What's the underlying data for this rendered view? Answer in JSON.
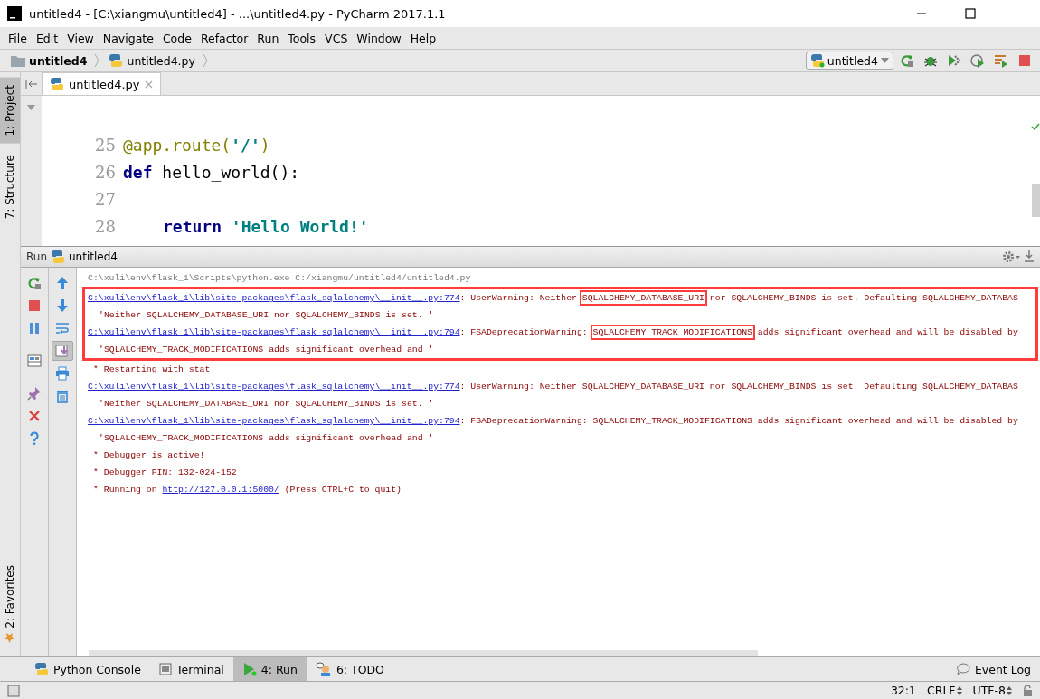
{
  "window": {
    "title": "untitled4 - [C:\\xiangmu\\untitled4] - ...\\untitled4.py - PyCharm 2017.1.1"
  },
  "menu": [
    "File",
    "Edit",
    "View",
    "Navigate",
    "Code",
    "Refactor",
    "Run",
    "Tools",
    "VCS",
    "Window",
    "Help"
  ],
  "breadcrumbs": [
    {
      "label": "untitled4",
      "kind": "folder"
    },
    {
      "label": "untitled4.py",
      "kind": "python"
    }
  ],
  "run_config": {
    "label": "untitled4"
  },
  "tool_stripe": {
    "top": [
      {
        "label": "1: Project",
        "selected": true
      },
      {
        "label": "7: Structure",
        "selected": false
      }
    ],
    "bottom": [
      {
        "label": "2: Favorites",
        "selected": false
      }
    ]
  },
  "editor": {
    "tabs": [
      {
        "label": "untitled4.py",
        "selected": true
      }
    ],
    "lines": [
      {
        "number": "25",
        "tokens": [
          {
            "text": "@app.route(",
            "kind": "decorator"
          },
          {
            "text": "'/'",
            "kind": "string"
          },
          {
            "text": ")",
            "kind": "decorator"
          }
        ]
      },
      {
        "number": "26",
        "tokens": [
          {
            "text": "def ",
            "kind": "keyword"
          },
          {
            "text": "hello_world():",
            "kind": "plain"
          }
        ]
      },
      {
        "number": "27"
      },
      {
        "number": "28",
        "indented": true,
        "tokens": [
          {
            "text": "return ",
            "kind": "keyword"
          },
          {
            "text": "'Hello World!'",
            "kind": "string"
          }
        ]
      }
    ]
  },
  "run_panel": {
    "title": "Run",
    "config": "untitled4",
    "scroll_to_end": true
  },
  "console": {
    "lines": [
      {
        "kind": "command",
        "annotated": false,
        "segments": [
          {
            "text": "C:\\xuli\\env\\flask_1\\Scripts\\python.exe C:/xiangmu/untitled4/untitled4.py"
          }
        ]
      },
      {
        "kind": "trace",
        "annotated": true,
        "segments": [
          {
            "text": "C:\\xuli\\env\\flask_1\\lib\\site-packages\\flask_sqlalchemy\\__init__.py:774",
            "link": true
          },
          {
            "text": ": UserWarning: Neither "
          },
          {
            "text": "SQLALCHEMY_DATABASE_URI",
            "annotated": true
          },
          {
            "text": " nor SQLALCHEMY_BINDS is set. Defaulting SQLALCHEMY_DATABAS"
          }
        ]
      },
      {
        "kind": "message",
        "annotated": true,
        "segments": [
          {
            "text": "'Neither SQLALCHEMY_DATABASE_URI nor SQLALCHEMY_BINDS is set. '"
          }
        ]
      },
      {
        "kind": "trace",
        "annotated": true,
        "segments": [
          {
            "text": "C:\\xuli\\env\\flask_1\\lib\\site-packages\\flask_sqlalchemy\\__init__.py:794",
            "link": true
          },
          {
            "text": ": FSADeprecationWarning: "
          },
          {
            "text": "SQLALCHEMY_TRACK_MODIFICATIONS",
            "annotated": true
          },
          {
            "text": " adds significant overhead and will be disabled by"
          }
        ]
      },
      {
        "kind": "message",
        "annotated": true,
        "segments": [
          {
            "text": "'SQLALCHEMY_TRACK_MODIFICATIONS adds significant overhead and '"
          }
        ]
      },
      {
        "kind": "status",
        "annotated": false,
        "segments": [
          {
            "text": "* Restarting with stat"
          }
        ]
      },
      {
        "kind": "trace",
        "annotated": false,
        "segments": [
          {
            "text": "C:\\xuli\\env\\flask_1\\lib\\site-packages\\flask_sqlalchemy\\__init__.py:774",
            "link": true
          },
          {
            "text": ": UserWarning: Neither SQLALCHEMY_DATABASE_URI nor SQLALCHEMY_BINDS is set. Defaulting SQLALCHEMY_DATABAS"
          }
        ]
      },
      {
        "kind": "message",
        "annotated": false,
        "segments": [
          {
            "text": "'Neither SQLALCHEMY_DATABASE_URI nor SQLALCHEMY_BINDS is set. '"
          }
        ]
      },
      {
        "kind": "trace",
        "annotated": false,
        "segments": [
          {
            "text": "C:\\xuli\\env\\flask_1\\lib\\site-packages\\flask_sqlalchemy\\__init__.py:794",
            "link": true
          },
          {
            "text": ": FSADeprecationWarning: SQLALCHEMY_TRACK_MODIFICATIONS adds significant overhead and will be disabled by"
          }
        ]
      },
      {
        "kind": "message",
        "annotated": false,
        "segments": [
          {
            "text": "'SQLALCHEMY_TRACK_MODIFICATIONS adds significant overhead and '"
          }
        ]
      },
      {
        "kind": "status",
        "annotated": false,
        "segments": [
          {
            "text": "* Debugger is active!"
          }
        ]
      },
      {
        "kind": "status",
        "annotated": false,
        "segments": [
          {
            "text": "* Debugger PIN: 132-024-152"
          }
        ]
      },
      {
        "kind": "status",
        "annotated": false,
        "segments": [
          {
            "text": "* Running on "
          },
          {
            "text": "http://127.0.0.1:5000/",
            "link": true
          },
          {
            "text": " (Press CTRL+C to quit)"
          }
        ]
      }
    ]
  },
  "tool_tabs": [
    {
      "label": "Python Console",
      "kind": "console",
      "selected": false
    },
    {
      "label": "Terminal",
      "kind": "terminal",
      "selected": false
    },
    {
      "label": "4: Run",
      "kind": "run",
      "selected": true
    },
    {
      "label": "6: TODO",
      "kind": "todo",
      "selected": false
    }
  ],
  "event_log": {
    "label": "Event Log"
  },
  "status_bar": {
    "position": "32:1",
    "line_separator": "CRLF",
    "encoding": "UTF-8"
  }
}
